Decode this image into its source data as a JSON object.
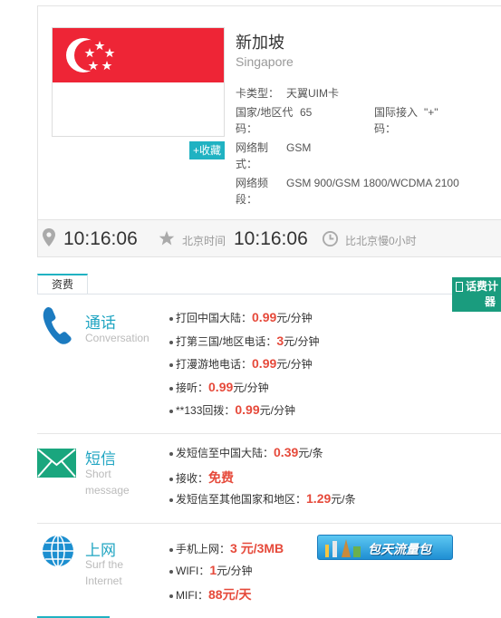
{
  "country": {
    "name_cn": "新加坡",
    "name_en": "Singapore"
  },
  "favorite_label": "+收藏",
  "info": {
    "card_type_label": "卡类型：",
    "card_type": "天翼UIM卡",
    "country_code_label_1": "国家/地区代",
    "country_code_label_2": "码：",
    "country_code": "65",
    "intl_access_label_1": "国际接入",
    "intl_access_label_2": "码：",
    "intl_access": "\"+\"",
    "network_label_1": "网络制",
    "network_label_2": "式：",
    "network": "GSM",
    "band_label_1": "网络频",
    "band_label_2": "段：",
    "band": "GSM 900/GSM 1800/WCDMA 2100"
  },
  "time": {
    "local_time": "10:16:06",
    "beijing_label": "北京时间",
    "beijing_time": "10:16:06",
    "diff_text": "比北京慢0小时"
  },
  "tabs": {
    "fee": "资费"
  },
  "calculator_label_1": "话费计",
  "calculator_label_2": "器",
  "sections": {
    "call": {
      "title": "通话",
      "subtitle": "Conversation",
      "rows": [
        {
          "label": "打回中国大陆：",
          "price": "0.99",
          "unit": "元/分钟"
        },
        {
          "label": "打第三国/地区电话：",
          "price": "3",
          "unit": "元/分钟"
        },
        {
          "label": "打漫游地电话：",
          "price": "0.99",
          "unit": "元/分钟"
        },
        {
          "label": "接听：",
          "price": "0.99",
          "unit": "元/分钟"
        },
        {
          "label": "**133回拨：",
          "price": "0.99",
          "unit": "元/分钟"
        }
      ]
    },
    "sms": {
      "title": "短信",
      "subtitle_1": "Short",
      "subtitle_2": "message",
      "rows": [
        {
          "label": "发短信至中国大陆：",
          "price": "0.39",
          "unit": "元/条"
        },
        {
          "label": "接收：",
          "price": "免费",
          "unit": ""
        },
        {
          "label": "发短信至其他国家和地区：",
          "price": "1.29",
          "unit": "元/条"
        }
      ]
    },
    "net": {
      "title": "上网",
      "subtitle_1": "Surf the",
      "subtitle_2": "Internet",
      "rows": [
        {
          "label": "手机上网：",
          "price": "3 元/3MB",
          "unit": ""
        },
        {
          "label": "WIFI：",
          "price": "1",
          "unit": "元/分钟"
        },
        {
          "label": "MIFI：",
          "price": "88元/天",
          "unit": ""
        }
      ],
      "promo_label": "包天流量包"
    }
  },
  "colors": {
    "accent": "#20a5c2",
    "price": "#e64a3b",
    "flag_red": "#ee2536",
    "calc_green": "#1a9c7e"
  }
}
